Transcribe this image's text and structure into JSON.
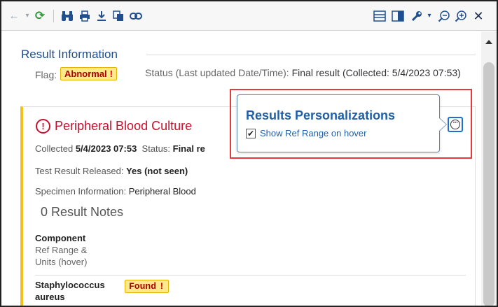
{
  "toolbar": {
    "icons": [
      "back-arrow-icon",
      "dropdown-arrow-icon",
      "refresh-icon",
      "binoculars-icon",
      "print-icon",
      "download-icon",
      "copy-icon",
      "link-icon",
      "layout-horizontal-icon",
      "layout-split-icon",
      "wrench-icon",
      "zoom-out-icon",
      "zoom-in-icon",
      "close-icon"
    ]
  },
  "result_info": {
    "title": "Result Information",
    "flag_label": "Flag:",
    "flag_value": "Abnormal",
    "flag_mark": "!",
    "status_label": "Status (Last updated Date/Time):",
    "status_value": "Final result (Collected: 5/4/2023 07:53)"
  },
  "test": {
    "alert_mark": "!",
    "title": "Peripheral Blood Culture",
    "collected_label": "Collected",
    "collected_value": "5/4/2023 07:53",
    "status_label": "Status:",
    "status_value": "Final re",
    "released_label": "Test Result Released:",
    "released_value": "Yes (not seen)",
    "specimen_label": "Specimen Information:",
    "specimen_value": "Peripheral Blood",
    "notes": "0 Result Notes",
    "component_header": "Component",
    "refrange_header": "Ref Range & Units (hover)",
    "row": {
      "name": "Staphylococcus aureus",
      "value": "Found",
      "mark": "!"
    }
  },
  "popover": {
    "title": "Results Personalizations",
    "checkbox_label": "Show Ref Range on hover",
    "checked": true
  },
  "colors": {
    "accent_blue": "#1f5fa8",
    "alert_red": "#c8102e",
    "badge_yellow": "#ffe98a",
    "highlight_red": "#e23b3b"
  }
}
